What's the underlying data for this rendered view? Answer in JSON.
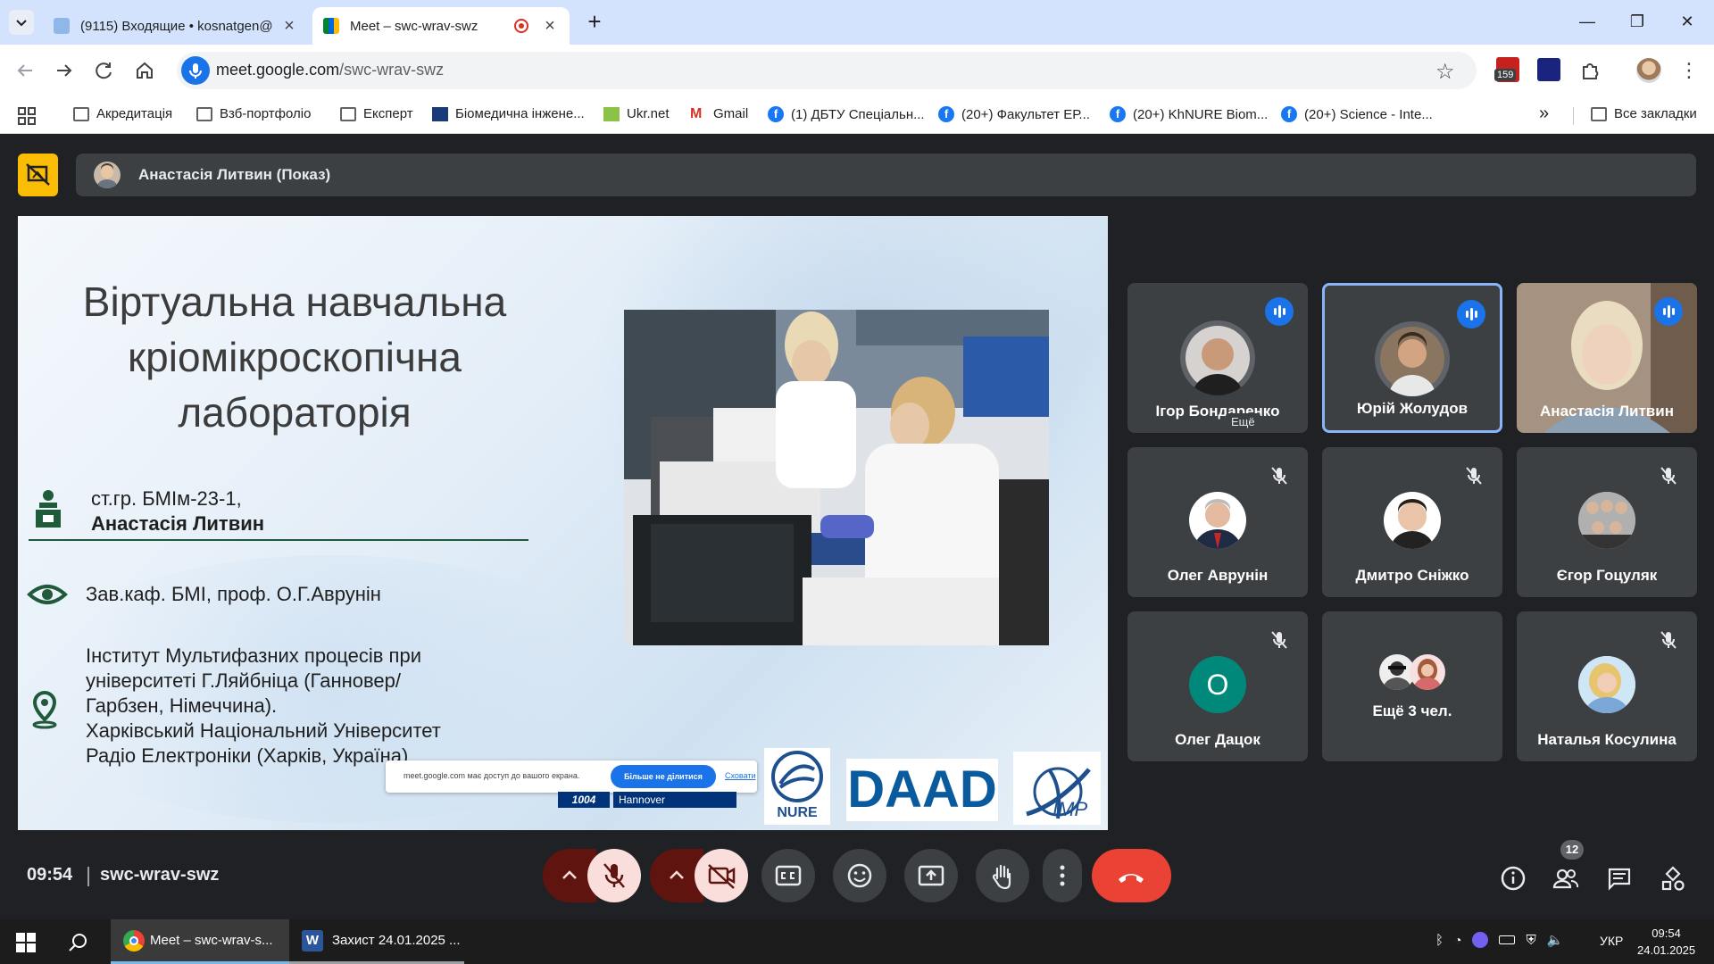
{
  "browser": {
    "tabs": [
      {
        "title": "(9115) Входящие • kosnatgen@",
        "active": false
      },
      {
        "title": "Meet – swc-wrav-swz",
        "active": true
      }
    ],
    "new_tab": "+",
    "window_controls": {
      "minimize": "—",
      "restore": "❐",
      "close": "✕"
    },
    "url_host": "meet.google.com",
    "url_path": "/swc-wrav-swz",
    "extension_badge": "159",
    "bookmarks": [
      {
        "label": "Акредитація",
        "icon": "folder-icon"
      },
      {
        "label": "Взб-портфоліо",
        "icon": "folder-icon"
      },
      {
        "label": "Експерт",
        "icon": "folder-icon"
      },
      {
        "label": "Біомедична інжене...",
        "icon": "site-icon"
      },
      {
        "label": "Ukr.net",
        "icon": "site-icon"
      },
      {
        "label": "Gmail",
        "icon": "gmail-icon"
      },
      {
        "label": "(1) ДБТУ Спеціальн...",
        "icon": "facebook-icon"
      },
      {
        "label": "(20+) Факультет ЕР...",
        "icon": "facebook-icon"
      },
      {
        "label": "(20+) KhNURE Biom...",
        "icon": "facebook-icon"
      },
      {
        "label": "(20+) Science - Inte...",
        "icon": "facebook-icon"
      }
    ],
    "bookmarks_more": "»",
    "all_bookmarks": "Все закладки"
  },
  "meet": {
    "presenter_label": "Анастасія Литвин (Показ)",
    "slide": {
      "title_lines": [
        "Віртуальна навчальна",
        "кріомікроскопічна",
        "лабораторія"
      ],
      "student_group": "ст.гр. БМІм-23-1,",
      "student_name": "Анастасія Литвин",
      "supervisor": "Зав.каф. БМІ, проф. О.Г.Аврунін",
      "institute_lines": [
        "Інститут Мультифазних процесів при",
        "університеті Г.Ляйбніца (Ганновер/",
        "Гарбзен, Німеччина).",
        "Харківський Національний Університет",
        "Радіо Електроніки (Харків, Україна)"
      ],
      "share_notice": "meet.google.com має доступ до вашого екрана.",
      "share_stop": "Більше не ділитися",
      "share_hide": "Сховати",
      "hannover_box_left": "1004",
      "hannover_box_right": "Hannover",
      "logo_nure": "NURE",
      "logo_daad": "DAAD",
      "logo_imp": "IMP"
    },
    "participants": [
      {
        "name": "Ігор Бондаренко",
        "state": "speaking",
        "avatar": "photo"
      },
      {
        "name": "Юрій Жолудов",
        "state": "speaking",
        "avatar": "photo",
        "active": true
      },
      {
        "name": "Анастасія Литвин",
        "state": "speaking",
        "avatar": "video"
      },
      {
        "name": "Олег Аврунін",
        "state": "muted",
        "avatar": "photo"
      },
      {
        "name": "Дмитро Сніжко",
        "state": "muted",
        "avatar": "photo"
      },
      {
        "name": "Єгор Гоцуляк",
        "state": "muted",
        "avatar": "photo"
      },
      {
        "name": "Олег Дацок",
        "state": "muted",
        "avatar": "letter",
        "letter": "О",
        "color": "#00897b"
      },
      {
        "name": "Ещё 3 чел.",
        "state": "none",
        "avatar": "group"
      },
      {
        "name": "Наталья Косулина",
        "state": "muted",
        "avatar": "photo"
      }
    ],
    "tooltip": "Ещё",
    "time": "09:54",
    "meeting_code": "swc-wrav-swz",
    "people_count": "12"
  },
  "taskbar": {
    "tasks": [
      {
        "label": "Meet – swc-wrav-s...",
        "icon": "chrome-icon"
      },
      {
        "label": "Захист 24.01.2025 ...",
        "icon": "word-icon"
      }
    ],
    "language": "УКР",
    "clock_time": "09:54",
    "clock_date": "24.01.2025"
  }
}
